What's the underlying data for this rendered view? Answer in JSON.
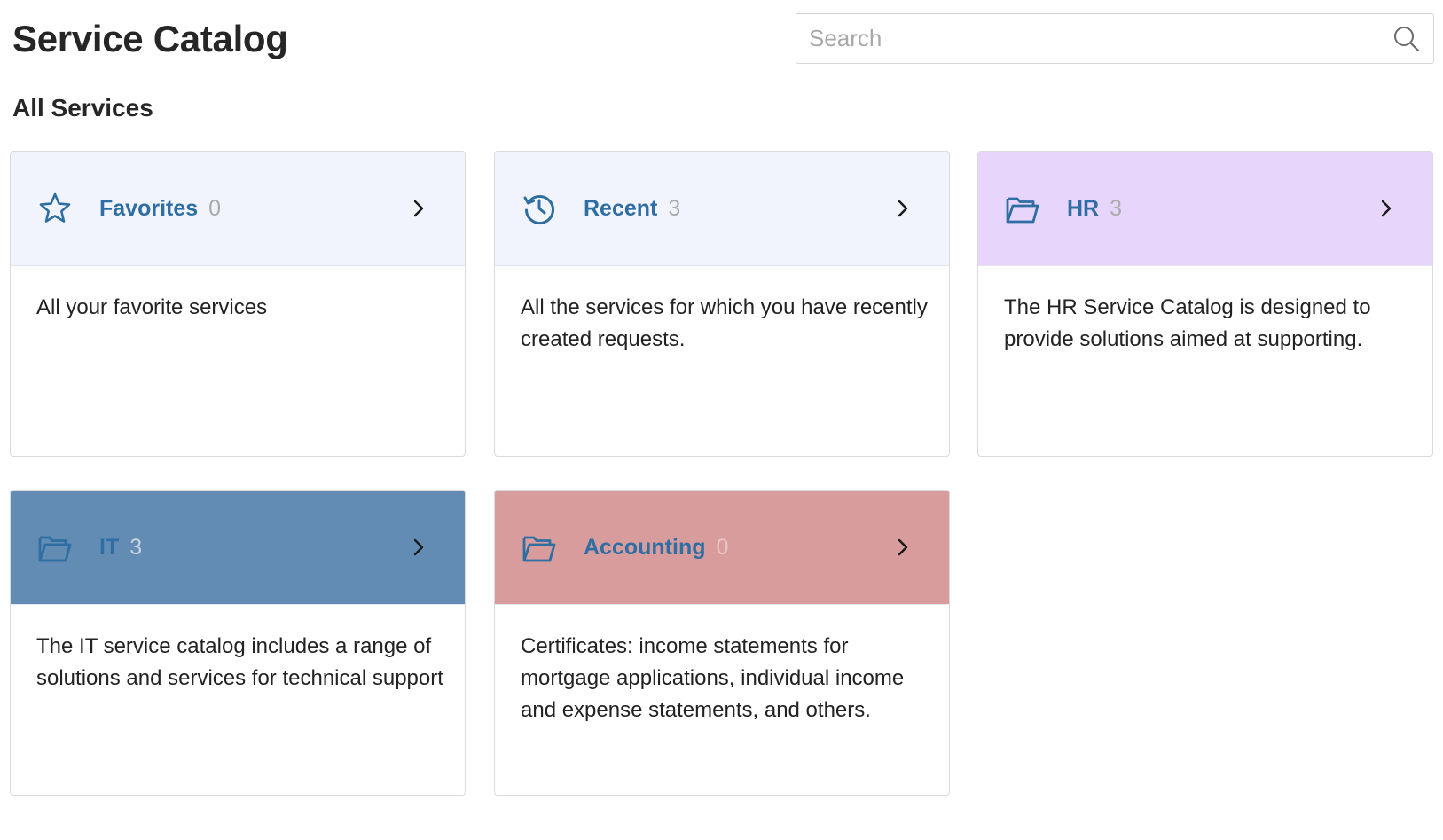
{
  "page": {
    "title": "Service Catalog",
    "section_title": "All Services"
  },
  "search": {
    "placeholder": "Search",
    "value": ""
  },
  "cards": [
    {
      "title": "Favorites",
      "count": "0",
      "description": "All your favorite services",
      "icon": "star-icon",
      "header_color": "#f1f4fd"
    },
    {
      "title": "Recent",
      "count": "3",
      "description": "All the services for which you have recently created requests.",
      "icon": "history-icon",
      "header_color": "#f1f4fd"
    },
    {
      "title": "HR",
      "count": "3",
      "description": "The HR Service Catalog is designed to provide solutions aimed at supporting.",
      "icon": "folder-icon",
      "header_color": "#e8d5fb"
    },
    {
      "title": "IT",
      "count": "3",
      "description": "The IT service catalog includes a range of solutions and services for technical support",
      "icon": "folder-icon",
      "header_color": "#628cb3"
    },
    {
      "title": "Accounting",
      "count": "0",
      "description": "Certificates: income statements for mortgage applications, individual income and expense statements, and others.",
      "icon": "folder-icon",
      "header_color": "#d99c9c"
    }
  ],
  "colors": {
    "accent": "#2e6ea3",
    "count": "#ababab",
    "border": "#dadada"
  }
}
